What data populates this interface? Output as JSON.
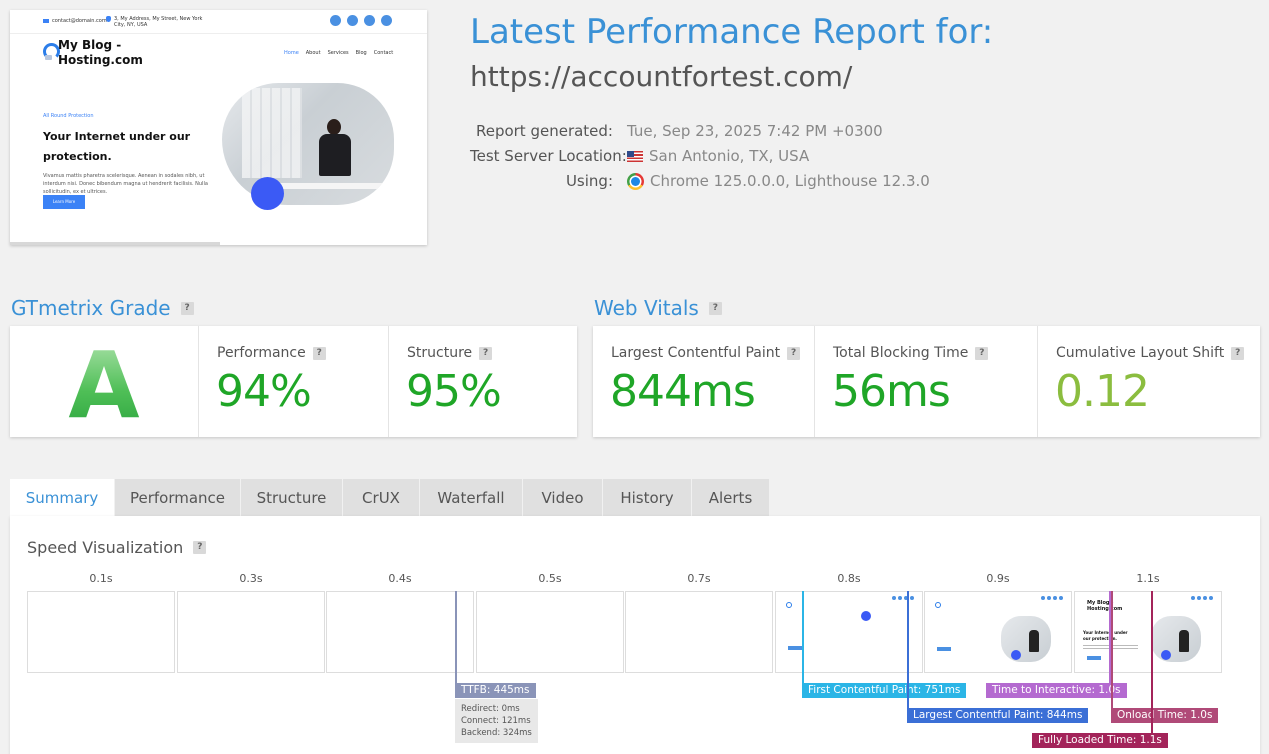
{
  "thumbnail": {
    "email": "contact@domain.com",
    "address": "3, My Address, My Street, New York City, NY, USA",
    "logo_text": "My Blog - Hosting.com",
    "nav": [
      "Home",
      "About",
      "Services",
      "Blog",
      "Contact"
    ],
    "hero_tag": "All Round Protection",
    "hero_title": "Your Internet under our protection.",
    "hero_text": "Vivamus mattis pharetra scelerisque. Aenean in sodales nibh, ut interdum nisi. Donec bibendum magna ut hendrerit facilisis. Nulla sollicitudin, ex et ultrices.",
    "hero_button": "Learn More"
  },
  "header": {
    "title": "Latest Performance Report for:",
    "url": "https://accountfortest.com/",
    "report_generated_label": "Report generated:",
    "report_generated_value": "Tue, Sep 23, 2025 7:42 PM +0300",
    "location_label": "Test Server Location:",
    "location_value": "San Antonio, TX, USA",
    "using_label": "Using:",
    "using_value": "Chrome 125.0.0.0, Lighthouse 12.3.0"
  },
  "grade": {
    "title": "GTmetrix Grade",
    "letter": "A",
    "performance_label": "Performance",
    "performance_value": "94%",
    "performance_pct": 94,
    "structure_label": "Structure",
    "structure_value": "95%",
    "structure_pct": 95
  },
  "vitals": {
    "title": "Web Vitals",
    "lcp_label": "Largest Contentful Paint",
    "lcp_value": "844ms",
    "tbt_label": "Total Blocking Time",
    "tbt_value": "56ms",
    "cls_label": "Cumulative Layout Shift",
    "cls_value": "0.12"
  },
  "tabs": [
    {
      "label": "Summary",
      "active": true
    },
    {
      "label": "Performance",
      "active": false
    },
    {
      "label": "Structure",
      "active": false
    },
    {
      "label": "CrUX",
      "active": false
    },
    {
      "label": "Waterfall",
      "active": false
    },
    {
      "label": "Video",
      "active": false
    },
    {
      "label": "History",
      "active": false
    },
    {
      "label": "Alerts",
      "active": false
    }
  ],
  "speed": {
    "title": "Speed Visualization",
    "frame_times": [
      "0.1s",
      "0.3s",
      "0.4s",
      "0.5s",
      "0.7s",
      "0.8s",
      "0.9s",
      "1.1s"
    ],
    "ttfb_label": "TTFB: 445ms",
    "ttfb_redirect": "Redirect: 0ms",
    "ttfb_connect": "Connect: 121ms",
    "ttfb_backend": "Backend: 324ms",
    "fcp_label": "First Contentful Paint: 751ms",
    "lcp_label": "Largest Contentful Paint: 844ms",
    "tti_label": "Time to Interactive: 1.0s",
    "onload_label": "Onload Time: 1.0s",
    "fully_loaded_label": "Fully Loaded Time: 1.1s"
  },
  "colors": {
    "accent": "#3a91d6",
    "green": "#1fa627",
    "light_green": "#8bbd3f",
    "ttfb": "#8a94b8",
    "fcp": "#2bb5e6",
    "lcp": "#3b6fd6",
    "tti": "#b46ad0",
    "onload": "#b04a78",
    "fully_loaded": "#a3245a"
  }
}
